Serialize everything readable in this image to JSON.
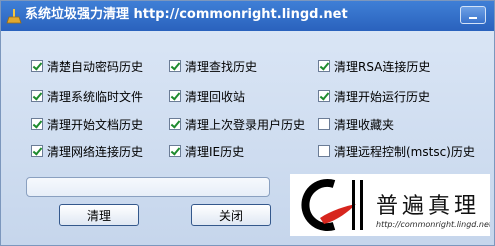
{
  "window": {
    "title": "系统垃圾强力清理 http://commonright.lingd.net"
  },
  "options": [
    {
      "label": "清楚自动密码历史",
      "checked": true
    },
    {
      "label": "清理查找历史",
      "checked": true
    },
    {
      "label": "清理RSA连接历史",
      "checked": true
    },
    {
      "label": "清理系统临时文件",
      "checked": true
    },
    {
      "label": "清理回收站",
      "checked": true
    },
    {
      "label": "清理开始运行历史",
      "checked": true
    },
    {
      "label": "清理开始文档历史",
      "checked": true
    },
    {
      "label": "清理上次登录用户历史",
      "checked": true
    },
    {
      "label": "清理收藏夹",
      "checked": false
    },
    {
      "label": "清理网络连接历史",
      "checked": true
    },
    {
      "label": "清理IE历史",
      "checked": true
    },
    {
      "label": "清理远程控制(mstsc)历史",
      "checked": false
    }
  ],
  "progress": {
    "value": 0
  },
  "buttons": {
    "clean_label": "清理",
    "close_label": "关闭"
  },
  "logo": {
    "chars": "普遍真理",
    "url": "http://commonright.lingd.net"
  },
  "colors": {
    "title_bar": "#2f6cc9",
    "check_mark": "#1e8b2e",
    "logo_red": "#d7261e"
  }
}
